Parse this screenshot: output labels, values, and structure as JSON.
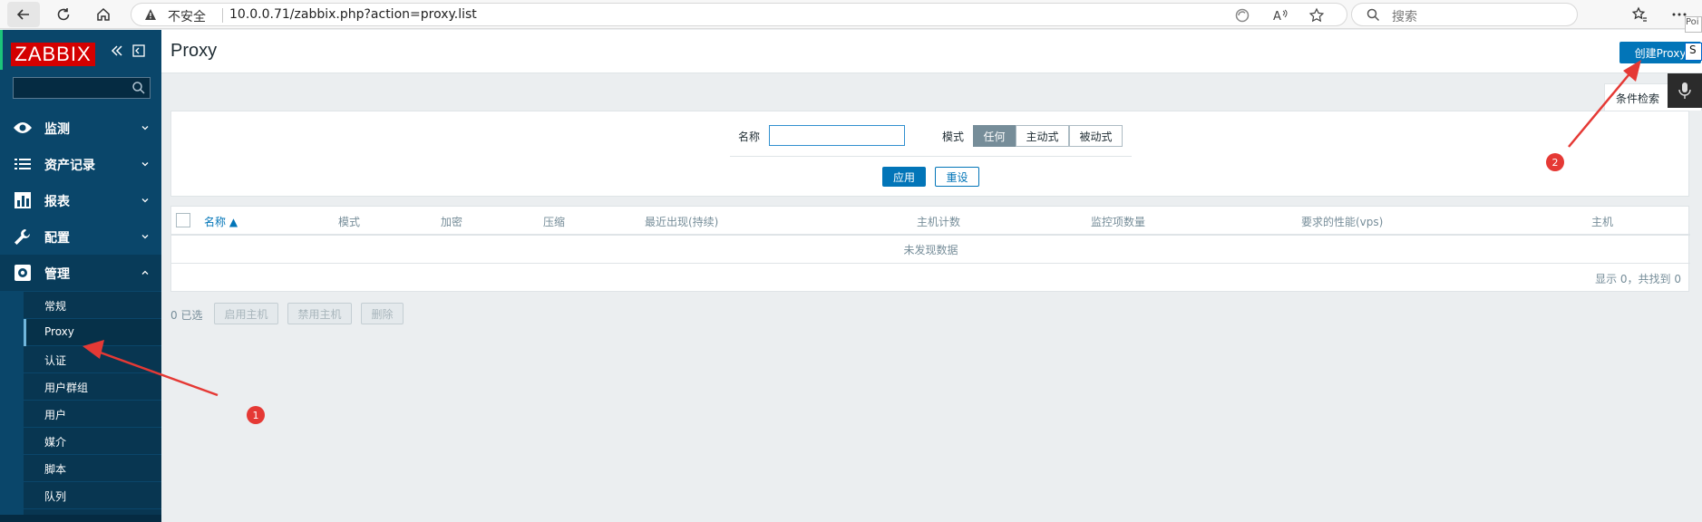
{
  "browser": {
    "insecure_label": "不安全",
    "url": "10.0.0.71/zabbix.php?action=proxy.list",
    "search_placeholder": "搜索",
    "icons": [
      "back-icon",
      "refresh-icon",
      "home-icon",
      "warning-icon",
      "translate-icon",
      "read-aloud-icon",
      "favorite-icon",
      "search-icon",
      "collections-icon",
      "more-icon"
    ]
  },
  "sidebar": {
    "logo": "ZABBIX",
    "search_value": "",
    "menu": [
      {
        "label": "监测",
        "icon": "eye-icon"
      },
      {
        "label": "资产记录",
        "icon": "list-icon"
      },
      {
        "label": "报表",
        "icon": "chart-icon"
      },
      {
        "label": "配置",
        "icon": "wrench-icon"
      },
      {
        "label": "管理",
        "icon": "gear-icon"
      }
    ],
    "submenu": [
      "常规",
      "Proxy",
      "认证",
      "用户群组",
      "用户",
      "媒介",
      "脚本",
      "队列"
    ],
    "selected_submenu": "Proxy"
  },
  "header": {
    "title": "Proxy",
    "create_button": "创建Proxy",
    "filter_tab": "条件检索"
  },
  "filter": {
    "name_label": "名称",
    "name_value": "",
    "mode_label": "模式",
    "modes": [
      "任何",
      "主动式",
      "被动式"
    ],
    "selected_mode": "任何",
    "apply": "应用",
    "reset": "重设"
  },
  "table": {
    "columns": [
      "名称 ▲",
      "模式",
      "加密",
      "压缩",
      "最近出现(持续)",
      "主机计数",
      "监控项数量",
      "要求的性能(vps)",
      "主机"
    ],
    "sorted_column": "名称",
    "empty_text": "未发现数据",
    "pager": "显示 0，共找到 0"
  },
  "actions": {
    "selected_count": "0 已选",
    "buttons": [
      "启用主机",
      "禁用主机",
      "删除"
    ]
  },
  "overlay": {
    "edge_tip": "Poi",
    "edge_box": "S",
    "badges": [
      "1",
      "2"
    ],
    "arrow_color": "#e53935"
  }
}
